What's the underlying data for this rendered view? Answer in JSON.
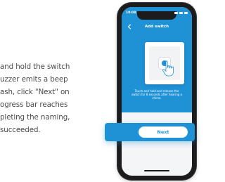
{
  "instructions": {
    "lines": [
      "and hold the switch",
      "uzzer emits a beep",
      "ash, click \"Next\" on",
      "ogress bar reaches",
      "pleting the naming,",
      " succeeded."
    ]
  },
  "phone": {
    "status_time": "10:08",
    "nav": {
      "title": "Add switch",
      "back_icon": "chevron-left-icon"
    },
    "hint": "Touch and hold and release the switch for 8 seconds after hearing a chime.",
    "next_label": "Next"
  },
  "colors": {
    "accent": "#1f92d6",
    "text": "#4a4a4a",
    "phone_frame": "#1c1c1e"
  }
}
